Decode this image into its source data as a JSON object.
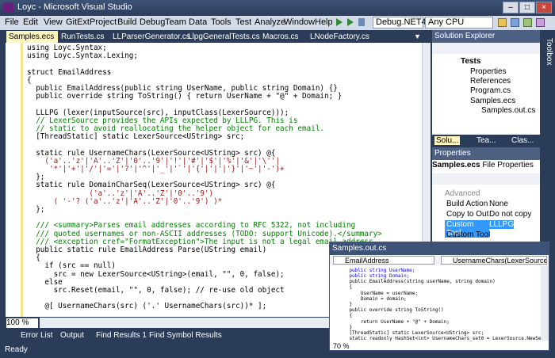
{
  "window": {
    "title": "Loyc - Microsoft Visual Studio"
  },
  "menu": [
    "File",
    "Edit",
    "View",
    "GitExt",
    "Project",
    "Build",
    "Debug",
    "Team",
    "Data",
    "Tools",
    "Test",
    "Analyze",
    "Window",
    "Help"
  ],
  "toolbar": {
    "config": "Debug.NET4",
    "platform": "Any CPU"
  },
  "doc_tabs": [
    "Samples.ecs",
    "RunTests.cs",
    "LLParserGenerator.cs",
    "LlpgGeneralTests.cs",
    "Macros.cs",
    "LNodeFactory.cs"
  ],
  "code_lines": [
    "using Loyc.Syntax;",
    "using Loyc.Syntax.Lexing;",
    "",
    "struct EmailAddress",
    "{",
    "  public EmailAddress(public string UserName, public string Domain) {}",
    "  public override string ToString() { return UserName + \"@\" + Domain; }",
    "",
    "  LLLPG (lexer(inputSource(src), inputClass(LexerSource)));",
    "  // LexerSource provides the APIs expected by LLLPG. This is",
    "  // static to avoid reallocating the helper object for each email.",
    "  [ThreadStatic] static LexerSource<UString> src;",
    "",
    "  static rule UsernameChars(LexerSource<UString> src) @{",
    "    ('a'..'z'|'A'..'Z'|'0'..'9'|'!'|'#'|'$'|'%'|'&'|'\\''|",
    "     '*'|'+'|'/'|'='|'?'|'^'|'_'|'`'|'{'|'|'|'}'|'~'|'-')+",
    "  };",
    "  static rule DomainCharSeq(LexerSource<UString> src) @{",
    "              ('a'..'z'|'A'..'Z'|'0'..'9')",
    "      ( '-'? ('a'..'z'|'A'..'Z'|'0'..'9') )*",
    "  };",
    "",
    "  /// <summary>Parses email addresses according to RFC 5322, not including",
    "  /// quoted usernames or non-ASCII addresses (TODO: support Unicode).</summary>",
    "  /// <exception cref=\"FormatException\">The input is not a legal email address.",
    "  public static rule EmailAddress Parse(UString email)",
    "  {",
    "    if (src == null)",
    "      src = new LexerSource<UString>(email, \"\", 0, false);",
    "    else",
    "      src.Reset(email, \"\", 0, false); // re-use old object",
    "",
    "    @[ UsernameChars(src) ('.' UsernameChars(src))* ];"
  ],
  "editor_zoom": "100 %",
  "bottom_tabs": [
    "Error List",
    "Output",
    "Find Results 1",
    "Find Symbol Results"
  ],
  "status": "Ready",
  "solution_explorer": {
    "title": "Solution Explorer",
    "items": [
      "Tests",
      "Properties",
      "References",
      "Program.cs",
      "Samples.ecs",
      "Samples.out.cs"
    ],
    "tabs": [
      "Solu...",
      "Tea...",
      "Clas..."
    ]
  },
  "properties": {
    "title": "Properties",
    "object": "Samples.ecs",
    "object_type": "File Properties",
    "category": "Advanced",
    "rows": [
      {
        "name": "Build Action",
        "value": "None"
      },
      {
        "name": "Copy to Outp",
        "value": "Do not copy"
      },
      {
        "name": "Custom Tool",
        "value": "LLLPG"
      },
      {
        "name": "Custom Tool",
        "value": ""
      }
    ]
  },
  "toolbox": {
    "label": "Toolbox"
  },
  "samples_out": {
    "title": "Samples.out.cs",
    "left_combo": "EmailAddress",
    "right_combo": "UsernameChars(LexerSource<",
    "zoom": "70 %",
    "lines": [
      "    public string UserName;",
      "    public string Domain;",
      "    public EmailAddress(string userName, string domain)",
      "    {",
      "        UserName = userName;",
      "        Domain = domain;",
      "    }",
      "    public override string ToString()",
      "    {",
      "        return UserName + \"@\" + Domain;",
      "    }",
      "    [ThreadStatic] static LexerSource<UString> src;",
      "    static readonly HashSet<int> UsernameChars_set0 = LexerSource.NewSet0"
    ]
  }
}
